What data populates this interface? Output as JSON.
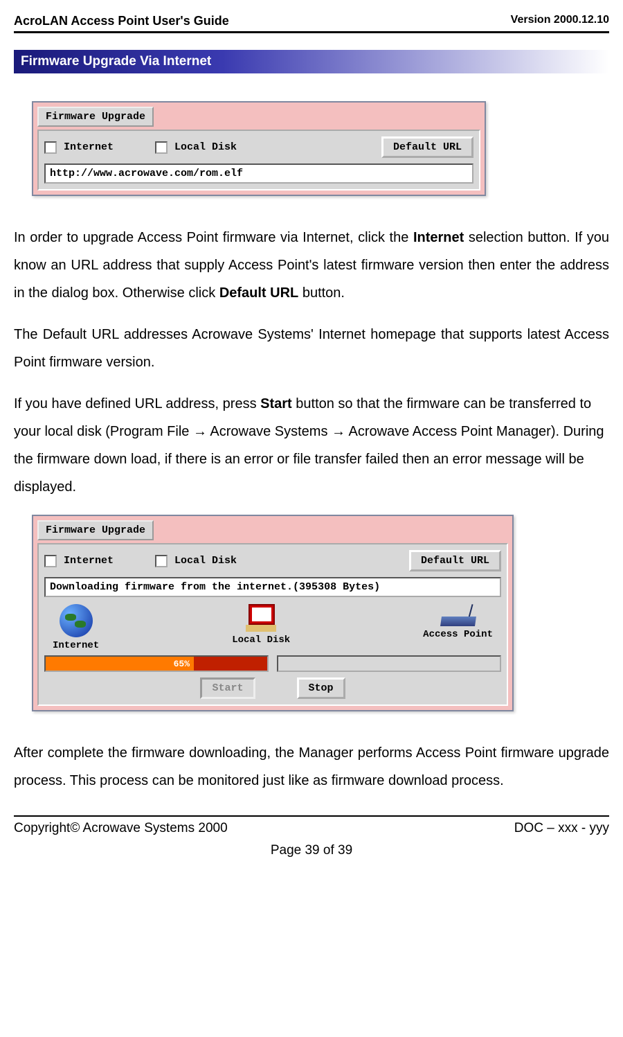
{
  "header": {
    "title": "AcroLAN Access Point User's Guide",
    "version": "Version 2000.12.10"
  },
  "section_heading": "Firmware Upgrade Via Internet",
  "screenshot1": {
    "tab": "Firmware Upgrade",
    "opt_internet": "Internet",
    "opt_local": "Local Disk",
    "btn_default": "Default URL",
    "url": "http://www.acrowave.com/rom.elf"
  },
  "para1_a": "In order to upgrade Access Point firmware via Internet, click the ",
  "para1_b_bold": "Internet",
  "para1_c": " selection button. If you know an URL address that supply Access Point's latest firmware version then enter the address in the dialog box. Otherwise click ",
  "para1_d_bold": "Default URL",
  "para1_e": " button.",
  "para2": "The Default URL addresses Acrowave Systems' Internet homepage that supports latest Access Point firmware version.",
  "para3_a": "If you have defined URL address, press ",
  "para3_b_bold": "Start",
  "para3_c": " button so that the firmware can be transferred to your local disk (Program File → Acrowave Systems → Acrowave Access Point Manager). During the firmware down load, if there is an error or file transfer failed then an error message will be displayed.",
  "screenshot2": {
    "tab": "Firmware Upgrade",
    "opt_internet": "Internet",
    "opt_local": "Local Disk",
    "btn_default": "Default URL",
    "status": "Downloading firmware from the internet.(395308 Bytes)",
    "label_internet": "Internet",
    "label_local": "Local Disk",
    "label_ap": "Access Point",
    "progress_pct": "65%",
    "btn_start": "Start",
    "btn_stop": "Stop"
  },
  "para4": "After complete the firmware downloading, the Manager performs Access Point firmware upgrade process. This process can be monitored just like as firmware download process.",
  "footer": {
    "copyright": "Copyright© Acrowave Systems 2000",
    "doc": "DOC – xxx - yyy",
    "page": "Page 39 of 39"
  }
}
